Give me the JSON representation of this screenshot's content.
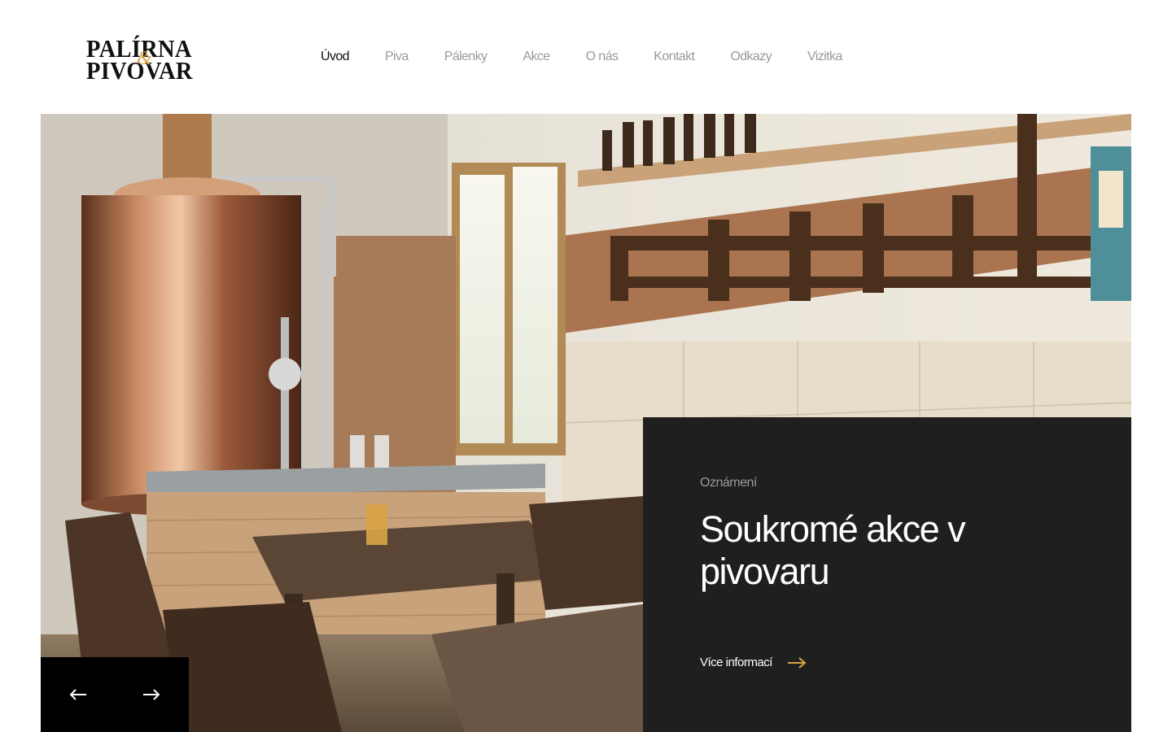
{
  "brand": {
    "logo_line1": "PALÍRNA",
    "logo_amp": "&",
    "logo_line2": "PIVOVAR",
    "accent": "#d9a441"
  },
  "nav": {
    "items": [
      {
        "label": "Úvod",
        "active": true
      },
      {
        "label": "Piva"
      },
      {
        "label": "Pálenky"
      },
      {
        "label": "Akce"
      },
      {
        "label": "O nás"
      },
      {
        "label": "Kontakt"
      },
      {
        "label": "Odkazy"
      },
      {
        "label": "Vizitka"
      }
    ],
    "active_color": "#111111",
    "inactive_color": "#9a9a9a"
  },
  "hero": {
    "image": "brewery-interior-photo",
    "kicker": "Oznámení",
    "title": "Soukromé akce v pivovaru",
    "link_label": "Více informací",
    "link_icon": "arrow-right-icon",
    "panel_color": "#1f1f1f"
  },
  "slider": {
    "prev_icon": "arrow-left-icon",
    "next_icon": "arrow-right-icon"
  }
}
